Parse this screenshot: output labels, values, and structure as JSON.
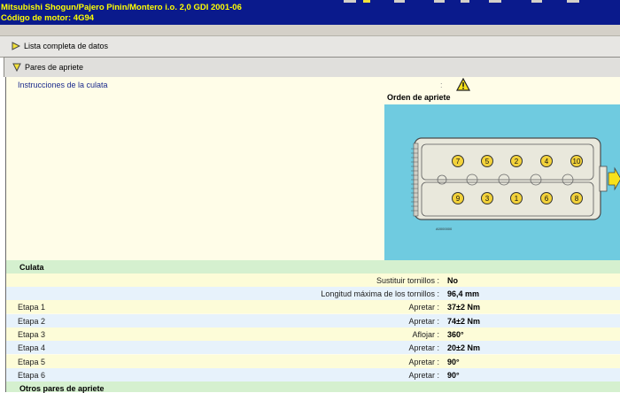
{
  "window": {
    "title_line1": "Mitsubishi   Shogun/Pajero Pinin/Montero i.o.  2,0 GDI 2001-06",
    "title_line2": "Código de motor: 4G94"
  },
  "sections": {
    "lista_completa": "Lista completa de datos",
    "pares_apriete": "Pares de apriete"
  },
  "instructions": {
    "link": "Instrucciones de la culata",
    "colon": ":",
    "warning_icon": "warning-triangle-icon"
  },
  "diagram": {
    "title": "Orden de apriete",
    "caption": "A0000000",
    "bolts_top": [
      "7",
      "5",
      "2",
      "4",
      "10"
    ],
    "bolts_bottom": [
      "9",
      "3",
      "1",
      "6",
      "8"
    ],
    "colors": {
      "background": "#6fcbe0",
      "head": "#e9e8dc",
      "bolt": "#f3d23a"
    }
  },
  "culata": {
    "header": "Culata",
    "rows": [
      {
        "label": "",
        "key": "Sustituir tornillos :",
        "value": "No"
      },
      {
        "label": "",
        "key": "Longitud máxima de los tornillos :",
        "value": "96,4 mm"
      },
      {
        "label": "Etapa 1",
        "key": "Apretar :",
        "value": "37±2 Nm"
      },
      {
        "label": "Etapa 2",
        "key": "Apretar :",
        "value": "74±2 Nm"
      },
      {
        "label": "Etapa 3",
        "key": "Aflojar :",
        "value": "360°"
      },
      {
        "label": "Etapa 4",
        "key": "Apretar :",
        "value": "20±2 Nm"
      },
      {
        "label": "Etapa 5",
        "key": "Apretar :",
        "value": "90°"
      },
      {
        "label": "Etapa 6",
        "key": "Apretar :",
        "value": "90°"
      }
    ]
  },
  "otros": {
    "header": "Otros pares de apriete"
  }
}
